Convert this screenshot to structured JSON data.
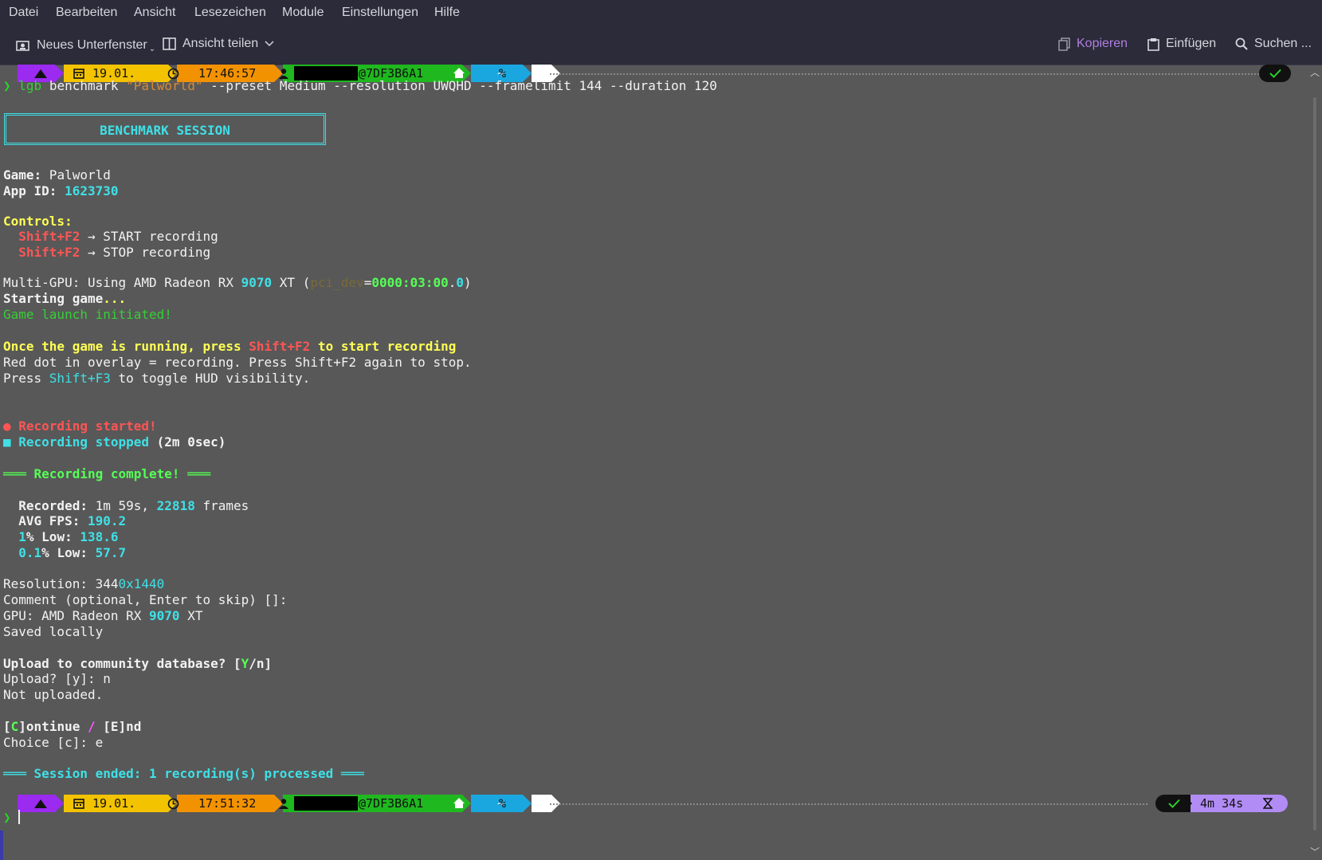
{
  "menu": [
    "Datei",
    "Bearbeiten",
    "Ansicht",
    "Lesezeichen",
    "Module",
    "Einstellungen",
    "Hilfe"
  ],
  "toolbar": {
    "new_tab": "Neues Unterfenster",
    "split_view": "Ansicht teilen",
    "copy": "Kopieren",
    "paste": "Einfügen",
    "search": "Suchen ..."
  },
  "prompt_top": {
    "date": "19.01.",
    "time": "17:46:57",
    "host": "@7DF3B6A1",
    "dir": "~",
    "sign": "%"
  },
  "prompt_bottom": {
    "date": "19.01.",
    "time": "17:51:32",
    "host": "@7DF3B6A1",
    "dir": "~",
    "sign": "%",
    "duration": "4m 34s"
  },
  "command": {
    "chevron": "❯",
    "tool": "lgb",
    "sub": " benchmark ",
    "arg": "\"Palworld\"",
    "rest": " --preset Medium --resolution UWQHD --framelimit 144 --duration 120"
  },
  "banner": "BENCHMARK SESSION",
  "game_label": "Game:",
  "game_value": " Palworld",
  "appid_label": "App ID:",
  "appid_value": "1623730",
  "controls_label": "Controls:",
  "controls": [
    {
      "key": "Shift+F2",
      "text": " → START recording"
    },
    {
      "key": "Shift+F2",
      "text": " → STOP recording"
    }
  ],
  "multigpu": {
    "a": "Multi-GPU: Using AMD Radeon RX ",
    "num": "9070",
    "b": " XT (",
    "pci": "pci_dev",
    "eq": "=",
    "addr": "0000:03:00",
    "dot": ".",
    "zero": "0",
    "close": ")"
  },
  "starting": {
    "a": "Starting game",
    "dots": "..."
  },
  "launch": "Game launch initiated!",
  "once": {
    "a": "Once the game is running, press ",
    "key": "Shift+F2",
    "b": " to start recording"
  },
  "reddot": "Red dot in overlay = recording. Press Shift+F2 again to stop.",
  "hud": {
    "a": "Press ",
    "key": "Shift+F3",
    "b": " to toggle HUD visibility."
  },
  "rec_started": "● Recording started!",
  "rec_stopped": {
    "icon": "■",
    "label": " Recording stopped",
    "time": " (2m 0sec)"
  },
  "complete": "═══ Recording complete! ═══",
  "stats": {
    "recorded_label": "Recorded:",
    "recorded_a": " 1m 59s, ",
    "frames": "22818",
    "frames_word": " frames",
    "avg_label": "AVG FPS:",
    "avg": "190.2",
    "low1_num": "1",
    "low1_label": "% Low:",
    "low1": "138.6",
    "low01_num": "0.1",
    "low01_label": "% Low:",
    "low01": "57.7"
  },
  "resolution": {
    "a": "Resolution: 344",
    "b": "0x1440"
  },
  "comment": "Comment (optional, Enter to skip) []:",
  "gpu": {
    "a": "GPU: AMD Radeon RX ",
    "num": "9070",
    "b": " XT"
  },
  "saved": "Saved locally",
  "upload_q": {
    "a": "Upload to community database? [",
    "y": "Y",
    "b": "/n]"
  },
  "upload_a": "Upload? [y]: n",
  "not_uploaded": "Not uploaded.",
  "cont": {
    "a": "[",
    "c": "C",
    "b": "]ontinue ",
    "slash": "/",
    "d": " [E]nd"
  },
  "choice": "Choice [c]: e",
  "session_end": "═══ Session ended: 1 recording(s) processed ═══",
  "colors": {
    "purple": "#9b2bf0",
    "yellow": "#f3c300",
    "orange": "#f39200",
    "green": "#1fb81f",
    "cyan": "#1aa7e0",
    "white": "#ffffff",
    "lavender": "#b28cf5"
  }
}
